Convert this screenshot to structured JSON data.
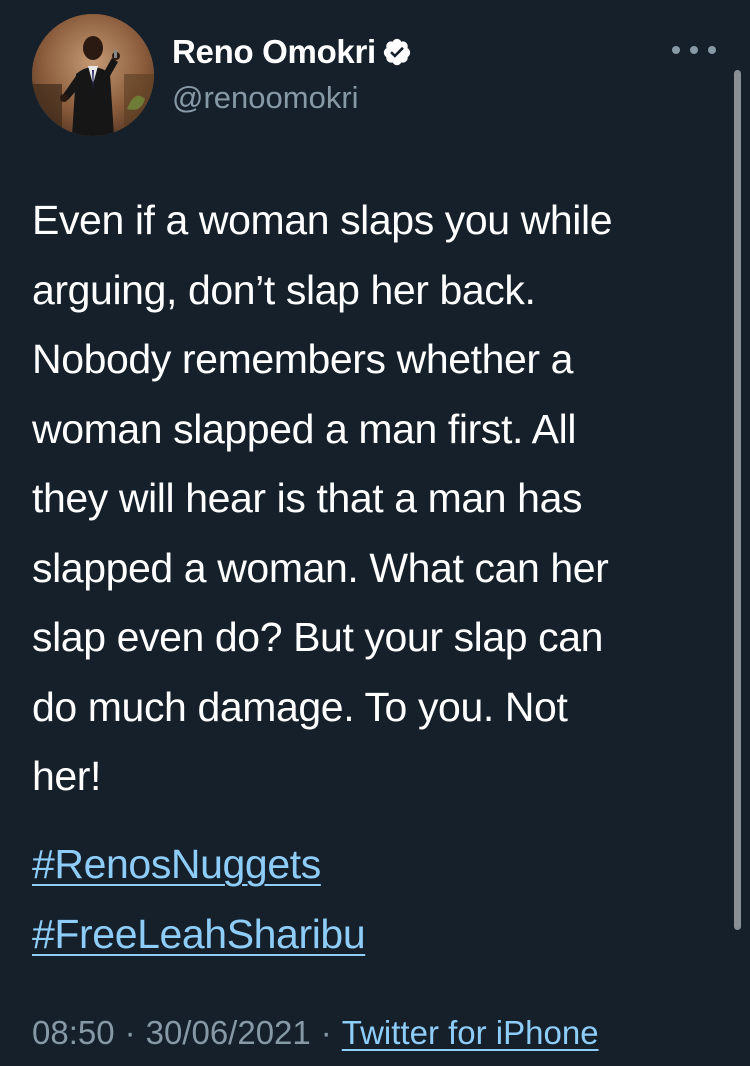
{
  "author": {
    "display_name": "Reno Omokri",
    "handle": "@renoomokri",
    "verified": true,
    "avatar_icon": "profile-photo-speaker-with-microphone"
  },
  "tweet": {
    "text_lines": [
      "Even if a woman slaps you while",
      "arguing, don’t slap her back.",
      "Nobody remembers whether a",
      "woman slapped a man first. All",
      "they will hear is that a man has",
      "slapped a woman. What can her",
      "slap even do? But your slap can",
      "do much damage. To you. Not",
      "her!"
    ],
    "hashtags": [
      "#RenosNuggets",
      "#FreeLeahSharibu"
    ]
  },
  "meta": {
    "time": "08:50",
    "date": "30/06/2021",
    "separator": "·",
    "source": "Twitter for iPhone"
  },
  "colors": {
    "background": "#15202b",
    "text": "#ffffff",
    "secondary": "#8899a6",
    "link": "#8ecdf8",
    "verified": "#ffffff"
  },
  "icons": {
    "more": "more-dots-icon",
    "verified": "verified-badge-icon"
  }
}
